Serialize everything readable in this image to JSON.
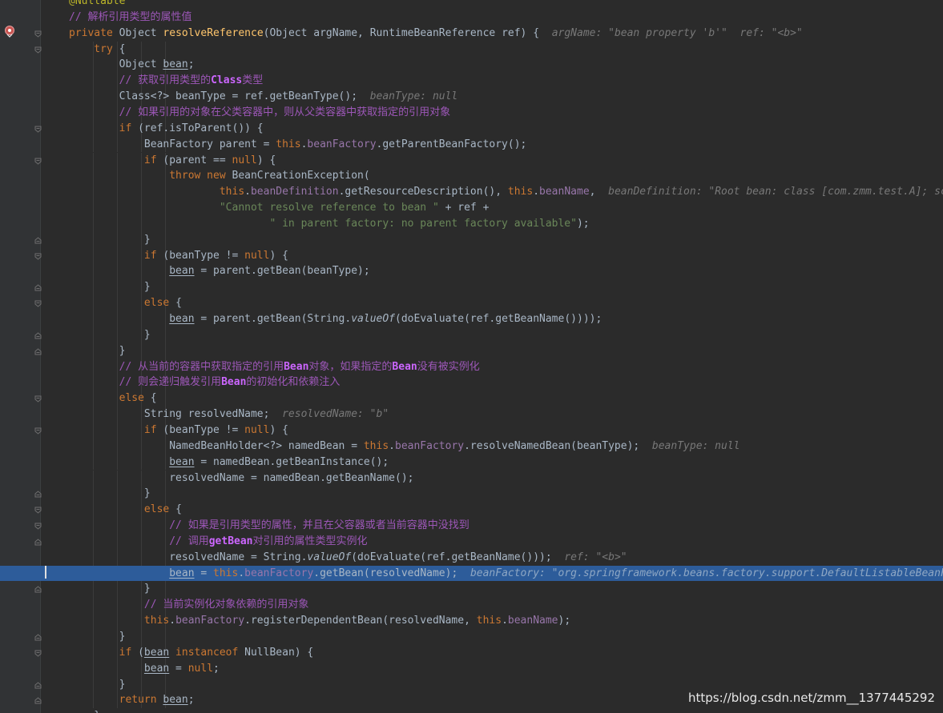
{
  "editor": {
    "colors": {
      "background": "#2b2b2b",
      "current_line": "#2d5c9a",
      "gutter": "#313335"
    },
    "current_line_index": 36,
    "lines": [
      [
        [
          "ann",
          "@Nullable"
        ]
      ],
      [
        [
          "com",
          "// 解析引用类型的属性值"
        ]
      ],
      [
        [
          "kw",
          "private "
        ],
        [
          "type",
          "Object "
        ],
        [
          "fn",
          "resolveReference"
        ],
        [
          "type",
          "(Object argName, RuntimeBeanReference ref) {  "
        ],
        [
          "hint",
          "argName: \"bean property 'b'\"  ref: \"<b>\""
        ]
      ],
      [
        [
          "kw",
          "    try "
        ],
        [
          "type",
          "{"
        ]
      ],
      [
        [
          "type",
          "        Object "
        ],
        [
          "under",
          "bean"
        ],
        [
          "type",
          ";"
        ]
      ],
      [
        [
          "com",
          "        // 获取引用类型的"
        ],
        [
          "comem",
          "Class"
        ],
        [
          "com",
          "类型"
        ]
      ],
      [
        [
          "type",
          "        Class<?> beanType = ref.getBeanType();  "
        ],
        [
          "hint",
          "beanType: null"
        ]
      ],
      [
        [
          "com",
          "        // 如果引用的对象在父类容器中，则从父类容器中获取指定的引用对象"
        ]
      ],
      [
        [
          "kw",
          "        if "
        ],
        [
          "type",
          "(ref.isToParent()) {"
        ]
      ],
      [
        [
          "type",
          "            BeanFactory parent = "
        ],
        [
          "kw",
          "this"
        ],
        [
          "type",
          "."
        ],
        [
          "field",
          "beanFactory"
        ],
        [
          "type",
          ".getParentBeanFactory();"
        ]
      ],
      [
        [
          "kw",
          "            if "
        ],
        [
          "type",
          "(parent == "
        ],
        [
          "kw",
          "null"
        ],
        [
          "type",
          ") {"
        ]
      ],
      [
        [
          "kw",
          "                throw new "
        ],
        [
          "type",
          "BeanCreationException("
        ]
      ],
      [
        [
          "kw",
          "                        this"
        ],
        [
          "type",
          "."
        ],
        [
          "field",
          "beanDefinition"
        ],
        [
          "type",
          ".getResourceDescription(), "
        ],
        [
          "kw",
          "this"
        ],
        [
          "type",
          "."
        ],
        [
          "field",
          "beanName"
        ],
        [
          "type",
          ",  "
        ],
        [
          "hint",
          "beanDefinition: \"Root bean: class [com.zmm.test.A]; scope=sing"
        ]
      ],
      [
        [
          "str",
          "                        \"Cannot resolve reference to bean \" "
        ],
        [
          "type",
          "+ ref +"
        ]
      ],
      [
        [
          "str",
          "                                \" in parent factory: no parent factory available\""
        ],
        [
          "type",
          ");"
        ]
      ],
      [
        [
          "type",
          "            }"
        ]
      ],
      [
        [
          "kw",
          "            if "
        ],
        [
          "type",
          "(beanType != "
        ],
        [
          "kw",
          "null"
        ],
        [
          "type",
          ") {"
        ]
      ],
      [
        [
          "type",
          "                "
        ],
        [
          "under",
          "bean"
        ],
        [
          "type",
          " = parent.getBean(beanType);"
        ]
      ],
      [
        [
          "type",
          "            }"
        ]
      ],
      [
        [
          "kw",
          "            else "
        ],
        [
          "type",
          "{"
        ]
      ],
      [
        [
          "type",
          "                "
        ],
        [
          "under",
          "bean"
        ],
        [
          "type",
          " = parent.getBean(String."
        ],
        [
          "ital",
          "valueOf"
        ],
        [
          "type",
          "(doEvaluate(ref.getBeanName())));"
        ]
      ],
      [
        [
          "type",
          "            }"
        ]
      ],
      [
        [
          "type",
          "        }"
        ]
      ],
      [
        [
          "com",
          "        // 从当前的容器中获取指定的引用"
        ],
        [
          "comem",
          "Bean"
        ],
        [
          "com",
          "对象，如果指定的"
        ],
        [
          "comem",
          "Bean"
        ],
        [
          "com",
          "没有被实例化"
        ]
      ],
      [
        [
          "com",
          "        // 则会递归触发引用"
        ],
        [
          "comem",
          "Bean"
        ],
        [
          "com",
          "的初始化和依赖注入"
        ]
      ],
      [
        [
          "kw",
          "        else "
        ],
        [
          "type",
          "{"
        ]
      ],
      [
        [
          "type",
          "            String resolvedName;  "
        ],
        [
          "hint",
          "resolvedName: \"b\""
        ]
      ],
      [
        [
          "kw",
          "            if "
        ],
        [
          "type",
          "(beanType != "
        ],
        [
          "kw",
          "null"
        ],
        [
          "type",
          ") {"
        ]
      ],
      [
        [
          "type",
          "                NamedBeanHolder<?> namedBean = "
        ],
        [
          "kw",
          "this"
        ],
        [
          "type",
          "."
        ],
        [
          "field",
          "beanFactory"
        ],
        [
          "type",
          ".resolveNamedBean(beanType);  "
        ],
        [
          "hint",
          "beanType: null"
        ]
      ],
      [
        [
          "type",
          "                "
        ],
        [
          "under",
          "bean"
        ],
        [
          "type",
          " = namedBean.getBeanInstance();"
        ]
      ],
      [
        [
          "type",
          "                resolvedName = namedBean.getBeanName();"
        ]
      ],
      [
        [
          "type",
          "            }"
        ]
      ],
      [
        [
          "kw",
          "            else "
        ],
        [
          "type",
          "{"
        ]
      ],
      [
        [
          "com",
          "                // 如果是引用类型的属性，并且在父容器或者当前容器中没找到"
        ]
      ],
      [
        [
          "com",
          "                // 调用"
        ],
        [
          "comem",
          "getBean"
        ],
        [
          "com",
          "对引用的属性类型实例化"
        ]
      ],
      [
        [
          "type",
          "                resolvedName = String."
        ],
        [
          "ital",
          "valueOf"
        ],
        [
          "type",
          "(doEvaluate(ref.getBeanName()));  "
        ],
        [
          "hint",
          "ref: \"<b>\""
        ]
      ],
      [
        [
          "type",
          "                "
        ],
        [
          "under",
          "bean"
        ],
        [
          "type",
          " = "
        ],
        [
          "kw",
          "this"
        ],
        [
          "type",
          "."
        ],
        [
          "field",
          "beanFactory"
        ],
        [
          "type",
          ".getBean(resolvedName);  "
        ],
        [
          "hint",
          "beanFactory: \"org.springframework.beans.factory.support.DefaultListableBeanFactory"
        ]
      ],
      [
        [
          "type",
          "            }"
        ]
      ],
      [
        [
          "com",
          "            // 当前实例化对象依赖的引用对象"
        ]
      ],
      [
        [
          "kw",
          "            this"
        ],
        [
          "type",
          "."
        ],
        [
          "field",
          "beanFactory"
        ],
        [
          "type",
          ".registerDependentBean(resolvedName, "
        ],
        [
          "kw",
          "this"
        ],
        [
          "type",
          "."
        ],
        [
          "field",
          "beanName"
        ],
        [
          "type",
          ");"
        ]
      ],
      [
        [
          "type",
          "        }"
        ]
      ],
      [
        [
          "kw",
          "        if "
        ],
        [
          "type",
          "("
        ],
        [
          "under",
          "bean"
        ],
        [
          "kw",
          " instanceof "
        ],
        [
          "type",
          "NullBean) {"
        ]
      ],
      [
        [
          "type",
          "            "
        ],
        [
          "under",
          "bean"
        ],
        [
          "type",
          " = "
        ],
        [
          "kw",
          "null"
        ],
        [
          "type",
          ";"
        ]
      ],
      [
        [
          "type",
          "        }"
        ]
      ],
      [
        [
          "kw",
          "        return "
        ],
        [
          "under",
          "bean"
        ],
        [
          "type",
          ";"
        ]
      ],
      [
        [
          "type",
          "    }"
        ]
      ]
    ],
    "fold_markers": [
      {
        "line": 2,
        "icon": "fold-open-icon"
      },
      {
        "line": 3,
        "icon": "fold-open-icon"
      },
      {
        "line": 8,
        "icon": "fold-open-icon"
      },
      {
        "line": 10,
        "icon": "fold-open-icon"
      },
      {
        "line": 15,
        "icon": "fold-close-icon"
      },
      {
        "line": 16,
        "icon": "fold-open-icon"
      },
      {
        "line": 18,
        "icon": "fold-close-icon"
      },
      {
        "line": 19,
        "icon": "fold-open-icon"
      },
      {
        "line": 21,
        "icon": "fold-close-icon"
      },
      {
        "line": 22,
        "icon": "fold-close-icon"
      },
      {
        "line": 25,
        "icon": "fold-open-icon"
      },
      {
        "line": 27,
        "icon": "fold-open-icon"
      },
      {
        "line": 31,
        "icon": "fold-close-icon"
      },
      {
        "line": 32,
        "icon": "fold-open-icon"
      },
      {
        "line": 33,
        "icon": "fold-open-icon"
      },
      {
        "line": 34,
        "icon": "fold-close-icon"
      },
      {
        "line": 37,
        "icon": "fold-close-icon"
      },
      {
        "line": 40,
        "icon": "fold-close-icon"
      },
      {
        "line": 41,
        "icon": "fold-open-icon"
      },
      {
        "line": 43,
        "icon": "fold-close-icon"
      },
      {
        "line": 44,
        "icon": "fold-close-icon"
      }
    ]
  },
  "watermark": "https://blog.csdn.net/zmm__1377445292"
}
